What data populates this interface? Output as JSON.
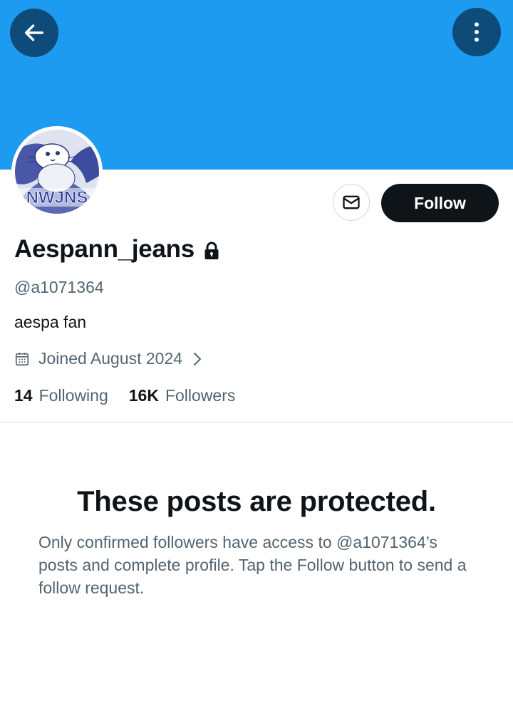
{
  "header": {
    "back_icon": "arrow-left-icon",
    "more_icon": "vertical-ellipsis-icon",
    "banner_color": "#1d9bf0",
    "button_color": "#0f4b78"
  },
  "avatar": {
    "description_text": "NWJNS"
  },
  "actions": {
    "message_icon": "envelope-icon",
    "follow_label": "Follow"
  },
  "profile": {
    "display_name": "Aespann_jeans",
    "protected_icon": "lock-icon",
    "handle": "@a1071364",
    "bio": "aespa fan",
    "joined": "Joined August 2024",
    "joined_icon": "calendar-icon"
  },
  "stats": {
    "following_count": "14",
    "following_label": "Following",
    "followers_count": "16K",
    "followers_label": "Followers"
  },
  "protected": {
    "title": "These posts are protected.",
    "description": "Only confirmed followers have access to @a1071364’s posts and complete profile. Tap the Follow button to send a follow request."
  }
}
